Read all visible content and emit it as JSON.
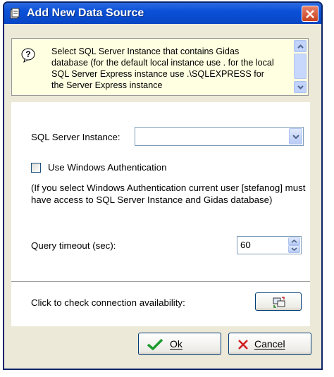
{
  "window": {
    "title": "Add New Data Source"
  },
  "info": {
    "text": "Select SQL Server Instance that contains Gidas database (for the default local instance use . for the local SQL Server Express instance use .\\SQLEXPRESS for the Server Express instance"
  },
  "form": {
    "instance_label": "SQL Server Instance:",
    "instance_value": "",
    "windows_auth_label": "Use Windows Authentication",
    "windows_auth_checked": false,
    "auth_note": "(If you select Windows Authentication current user [stefanog] must have access to SQL Server Instance and Gidas database)",
    "timeout_label": "Query timeout (sec):",
    "timeout_value": "60",
    "check_label": "Click to check connection availability:"
  },
  "buttons": {
    "ok": "Ok",
    "cancel": "Cancel"
  },
  "colors": {
    "titlebar": "#0a50d8",
    "info_bg": "#ffffe1",
    "dialog_bg": "#ece9d8",
    "close": "#c8401e"
  }
}
